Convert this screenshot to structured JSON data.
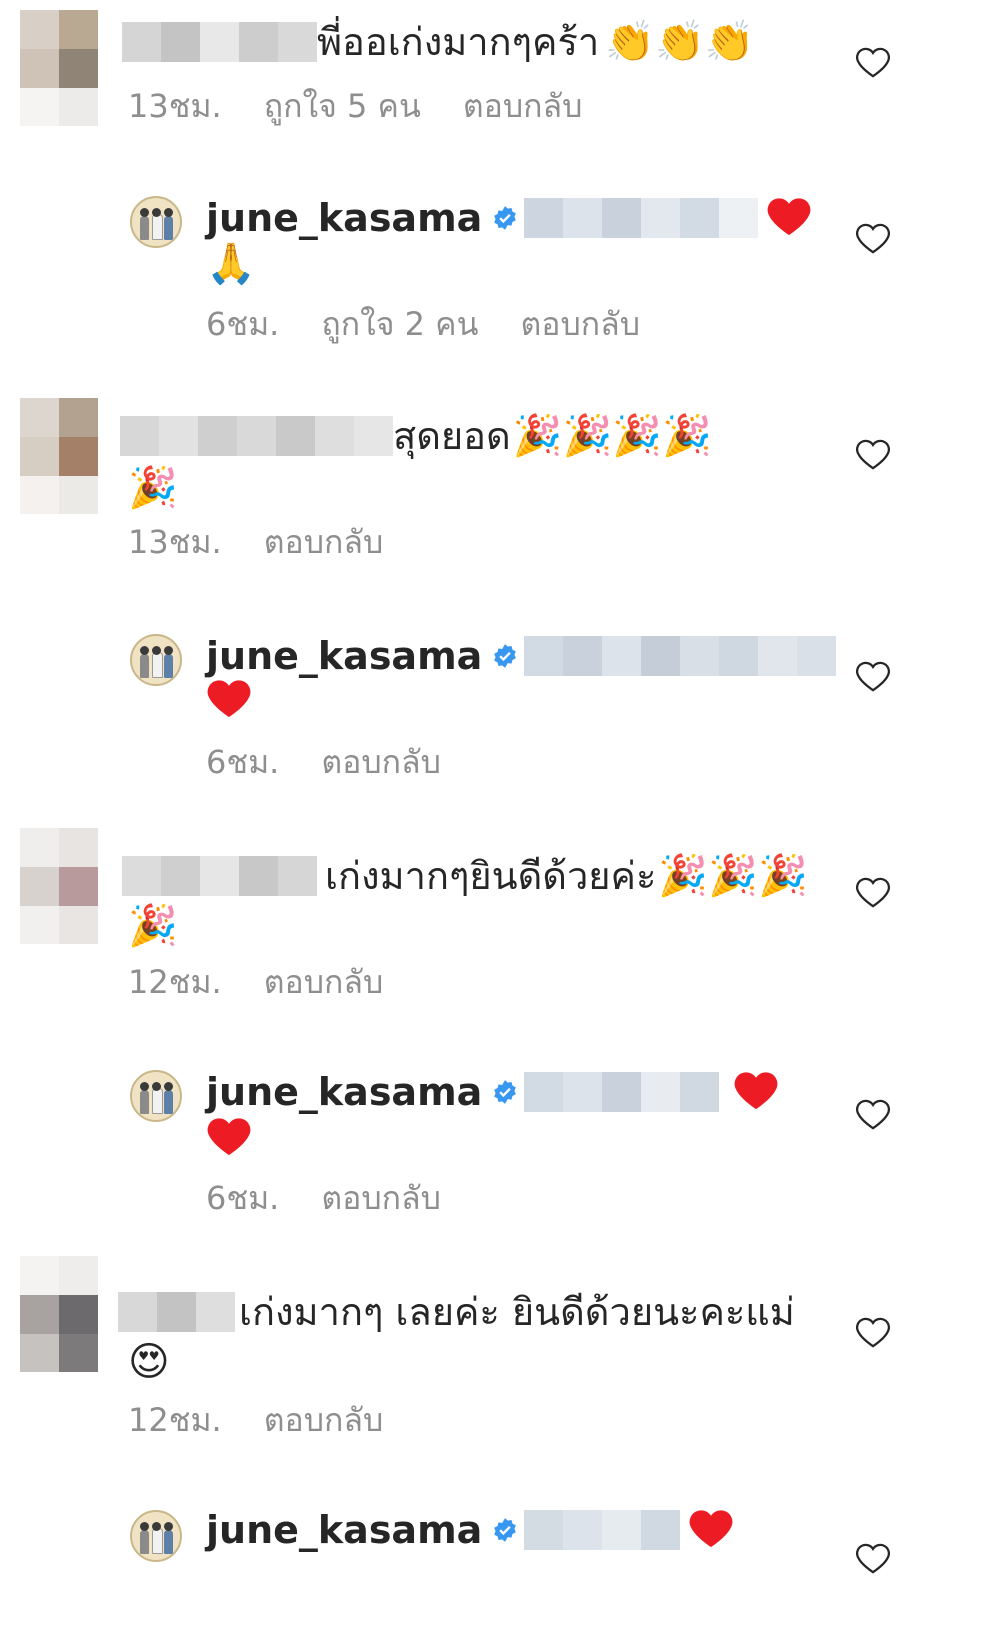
{
  "username_reply": "june_kasama",
  "reply_label": "ตอบกลับ",
  "colors": {
    "meta_gray": "#8e8e8e",
    "verified_blue": "#3897f0",
    "heart_red": "#ed1c24"
  },
  "comments": [
    {
      "text": "พี่ออเก่งมากๆคร้า",
      "emoji": "👏👏👏",
      "time": "13ชม.",
      "likes": "ถูกใจ 5 คน"
    },
    {
      "emoji": "❤️",
      "line2_emoji": "🙏",
      "time": "6ชม.",
      "likes": "ถูกใจ 2 คน"
    },
    {
      "text": "สุดยอด",
      "emoji": "🎉🎉🎉🎉",
      "line2_emoji": "🎉",
      "time": "13ชม."
    },
    {
      "line2_emoji": "❤️",
      "time": "6ชม."
    },
    {
      "text": "เก่งมากๆยินดีด้วยค่ะ",
      "emoji": "🎉🎉🎉",
      "line2_emoji": "🎉",
      "time": "12ชม."
    },
    {
      "emoji": "❤️",
      "line2_emoji": "❤️",
      "time": "6ชม."
    },
    {
      "text": "เก่งมากๆ เลยค่ะ ยินดีด้วยนะคะแม่",
      "line2_emoji": "😍",
      "time": "12ชม."
    },
    {
      "emoji": "❤️"
    }
  ]
}
